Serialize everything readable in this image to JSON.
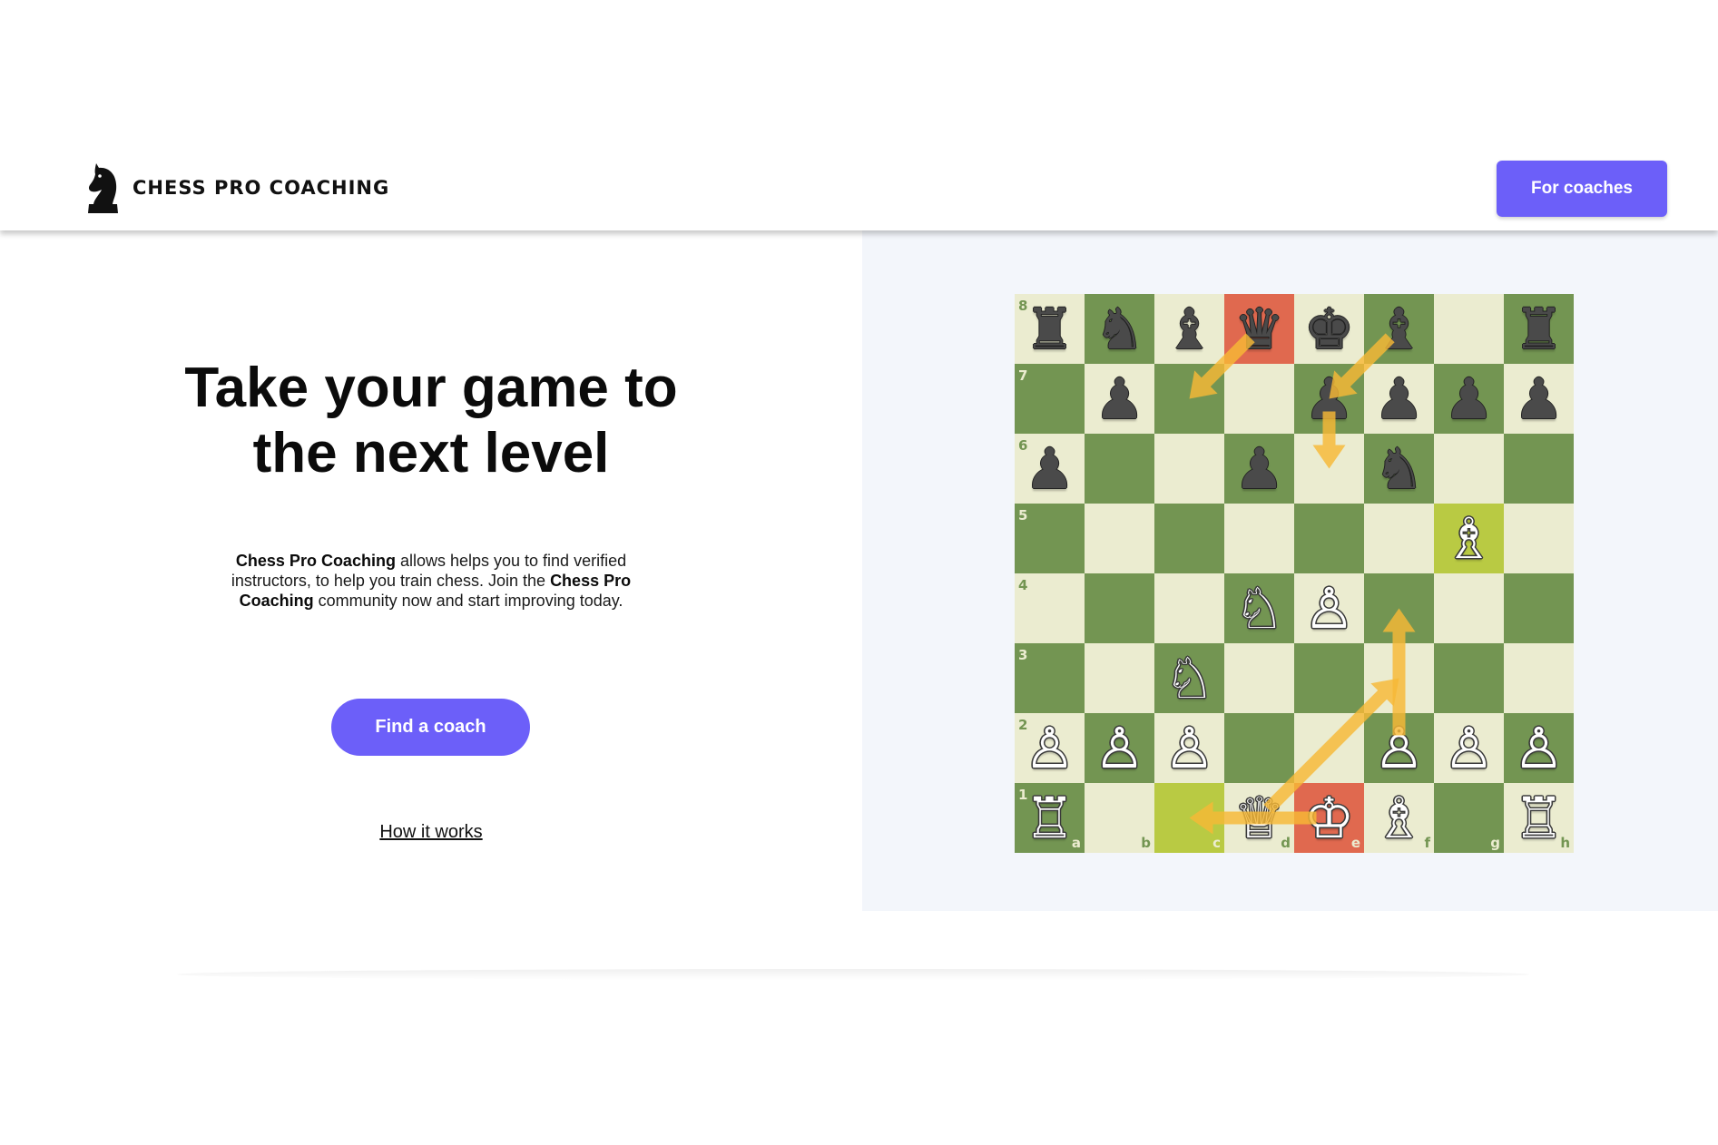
{
  "header": {
    "logo_text": "CHESS PRO COACHING",
    "logo_icon": "knight-icon",
    "coaches_button": "For coaches"
  },
  "hero": {
    "title_line1": "Take your game to",
    "title_line2": "the next level",
    "description": {
      "brand": "Chess Pro Coaching",
      "part1": " allows helps you to find verified instructors, to help you train chess. Join the ",
      "part2": " community now and start improving today."
    },
    "find_button": "Find a coach",
    "how_link": "How it works"
  },
  "board": {
    "colors": {
      "light": "#ebecd0",
      "dark": "#739552",
      "highlight_red": "#e0694f",
      "highlight_yellow": "#b9ca43",
      "arrow": "#f6b836"
    },
    "rank_labels": [
      "8",
      "7",
      "6",
      "5",
      "4",
      "3",
      "2",
      "1"
    ],
    "file_labels": [
      "a",
      "b",
      "c",
      "d",
      "e",
      "f",
      "g",
      "h"
    ],
    "highlights": [
      {
        "square": "d8",
        "type": "red"
      },
      {
        "square": "e1",
        "type": "red"
      },
      {
        "square": "g5",
        "type": "yellow"
      },
      {
        "square": "c1",
        "type": "yellow"
      }
    ],
    "pieces": [
      {
        "square": "a8",
        "color": "black",
        "type": "rook"
      },
      {
        "square": "b8",
        "color": "black",
        "type": "knight"
      },
      {
        "square": "c8",
        "color": "black",
        "type": "bishop"
      },
      {
        "square": "d8",
        "color": "black",
        "type": "queen"
      },
      {
        "square": "e8",
        "color": "black",
        "type": "king"
      },
      {
        "square": "f8",
        "color": "black",
        "type": "bishop"
      },
      {
        "square": "h8",
        "color": "black",
        "type": "rook"
      },
      {
        "square": "b7",
        "color": "black",
        "type": "pawn"
      },
      {
        "square": "e7",
        "color": "black",
        "type": "pawn"
      },
      {
        "square": "f7",
        "color": "black",
        "type": "pawn"
      },
      {
        "square": "g7",
        "color": "black",
        "type": "pawn"
      },
      {
        "square": "h7",
        "color": "black",
        "type": "pawn"
      },
      {
        "square": "a6",
        "color": "black",
        "type": "pawn"
      },
      {
        "square": "d6",
        "color": "black",
        "type": "pawn"
      },
      {
        "square": "f6",
        "color": "black",
        "type": "knight"
      },
      {
        "square": "g5",
        "color": "white",
        "type": "bishop"
      },
      {
        "square": "d4",
        "color": "white",
        "type": "knight"
      },
      {
        "square": "e4",
        "color": "white",
        "type": "pawn"
      },
      {
        "square": "c3",
        "color": "white",
        "type": "knight"
      },
      {
        "square": "a2",
        "color": "white",
        "type": "pawn"
      },
      {
        "square": "b2",
        "color": "white",
        "type": "pawn"
      },
      {
        "square": "c2",
        "color": "white",
        "type": "pawn"
      },
      {
        "square": "f2",
        "color": "white",
        "type": "pawn"
      },
      {
        "square": "g2",
        "color": "white",
        "type": "pawn"
      },
      {
        "square": "h2",
        "color": "white",
        "type": "pawn"
      },
      {
        "square": "a1",
        "color": "white",
        "type": "rook"
      },
      {
        "square": "d1",
        "color": "white",
        "type": "queen"
      },
      {
        "square": "e1",
        "color": "white",
        "type": "king"
      },
      {
        "square": "f1",
        "color": "white",
        "type": "bishop"
      },
      {
        "square": "h1",
        "color": "white",
        "type": "rook"
      }
    ],
    "arrows": [
      {
        "from": "d8",
        "to": "c7"
      },
      {
        "from": "f8",
        "to": "e7"
      },
      {
        "from": "e7",
        "to": "e6"
      },
      {
        "from": "f2",
        "to": "f4"
      },
      {
        "from": "d1",
        "to": "f3"
      },
      {
        "from": "e1",
        "to": "c1"
      }
    ]
  }
}
